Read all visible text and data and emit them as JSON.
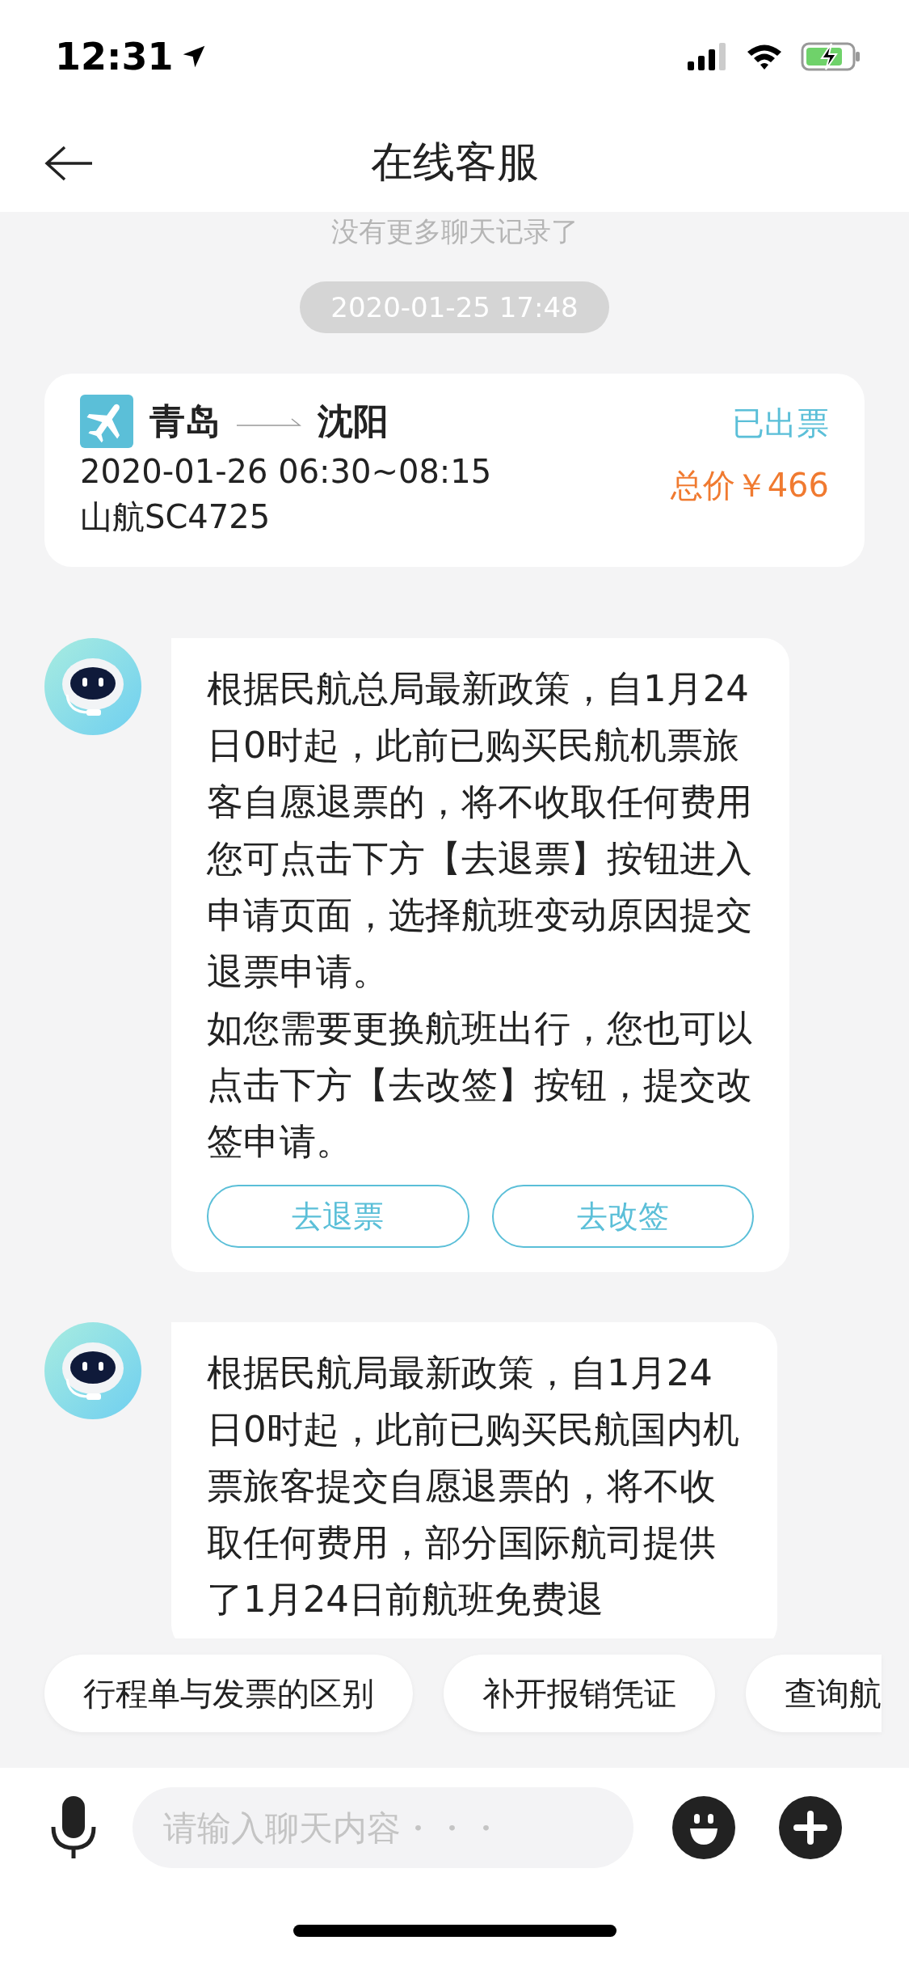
{
  "status_bar": {
    "time": "12:31"
  },
  "header": {
    "title": "在线客服"
  },
  "history_note": "没有更多聊天记录了",
  "timestamp": "2020-01-25 17:48",
  "order_card": {
    "from": "青岛",
    "to": "沈阳",
    "status": "已出票",
    "datetime": "2020-01-26 06:30~08:15",
    "price": "总价￥466",
    "flight": "山航SC4725"
  },
  "messages": [
    {
      "paragraphs": [
        "根据民航总局最新政策，自1月24日0时起，此前已购买民航机票旅客自愿退票的，将不收取任何费用",
        "您可点击下方【去退票】按钮进入申请页面，选择航班变动原因提交退票申请。",
        "如您需要更换航班出行，您也可以点击下方【去改签】按钮，提交改签申请。"
      ],
      "actions": [
        "去退票",
        "去改签"
      ]
    },
    {
      "paragraphs": [
        "根据民航局最新政策，自1月24日0时起，此前已购买民航国内机票旅客提交自愿退票的，将不收取任何费用，部分国际航司提供了1月24日前航班免费退"
      ]
    }
  ],
  "quick_replies": [
    "行程单与发票的区别",
    "补开报销凭证",
    "查询航"
  ],
  "input": {
    "placeholder": "请输入聊天内容・・・"
  }
}
